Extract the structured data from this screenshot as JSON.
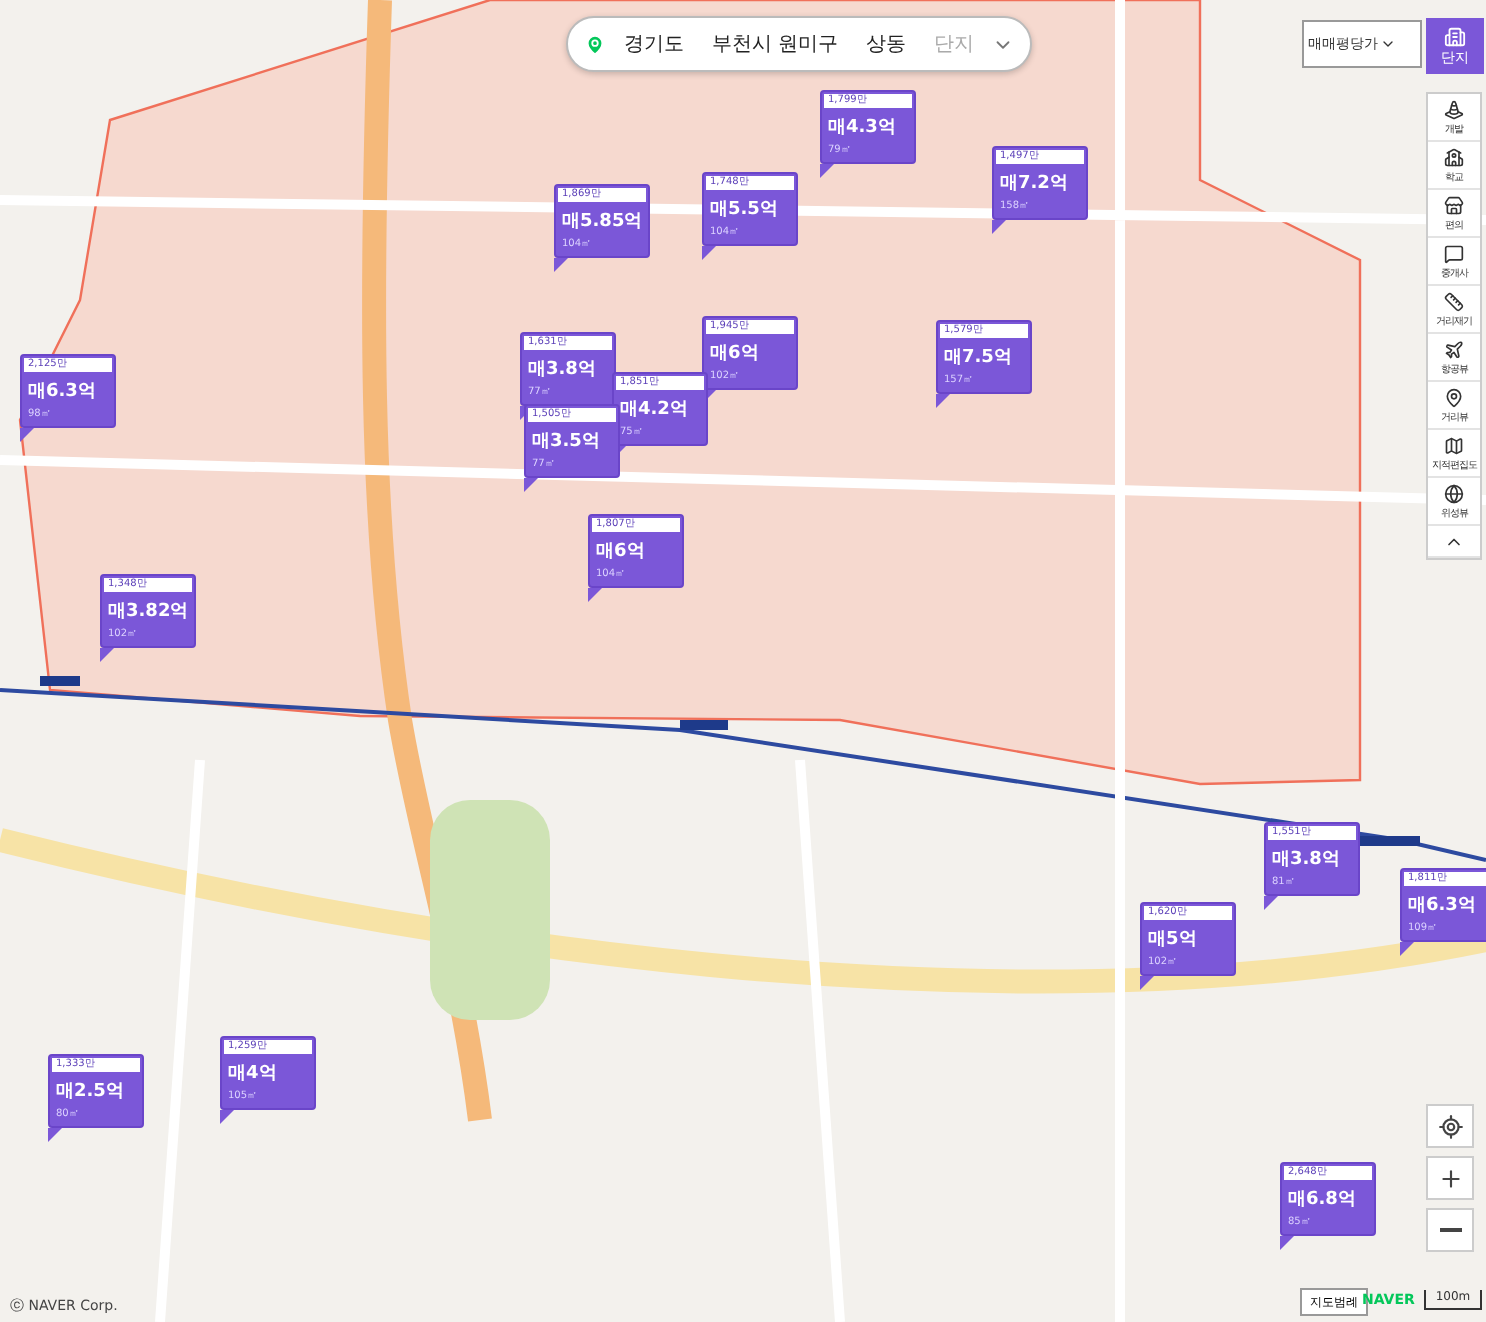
{
  "search_bar": {
    "crumbs": [
      {
        "label": "경기도",
        "muted": false
      },
      {
        "label": "부천시 원미구",
        "muted": false
      },
      {
        "label": "상동",
        "muted": false
      },
      {
        "label": "단지",
        "muted": true
      }
    ]
  },
  "price_type_select": {
    "value": "매매평당가"
  },
  "complex_button": {
    "label": "단지",
    "selected": true
  },
  "toolbar": [
    {
      "kind": "cone",
      "label": "개발"
    },
    {
      "kind": "school",
      "label": "학교"
    },
    {
      "kind": "store",
      "label": "편의"
    },
    {
      "kind": "agent",
      "label": "중개사"
    },
    {
      "kind": "ruler",
      "label": "거리재기"
    },
    {
      "kind": "plane",
      "label": "항공뷰"
    },
    {
      "kind": "pin",
      "label": "거리뷰"
    },
    {
      "kind": "map",
      "label": "지적편집도"
    },
    {
      "kind": "globe",
      "label": "위성뷰"
    },
    {
      "kind": "collapse"
    }
  ],
  "markers": [
    {
      "unit_price": "1,799만",
      "price": "매4.3억",
      "area": "79㎡"
    },
    {
      "unit_price": "1,869만",
      "price": "매5.85억",
      "area": "104㎡"
    },
    {
      "unit_price": "1,748만",
      "price": "매5.5억",
      "area": "104㎡"
    },
    {
      "unit_price": "1,497만",
      "price": "매7.2억",
      "area": "158㎡"
    },
    {
      "unit_price": "2,125만",
      "price": "매6.3억",
      "area": "98㎡"
    },
    {
      "unit_price": "1,945만",
      "price": "매6억",
      "area": "102㎡"
    },
    {
      "unit_price": "1,579만",
      "price": "매7.5억",
      "area": "157㎡"
    },
    {
      "unit_price": "1,631만",
      "price": "매3.8억",
      "area": "77㎡"
    },
    {
      "unit_price": "1,851만",
      "price": "매4.2억",
      "area": "75㎡"
    },
    {
      "unit_price": "1,505만",
      "price": "매3.5억",
      "area": "77㎡"
    },
    {
      "unit_price": "1,807만",
      "price": "매6억",
      "area": "104㎡"
    },
    {
      "unit_price": "1,348만",
      "price": "매3.82억",
      "area": "102㎡"
    },
    {
      "unit_price": "1,551만",
      "price": "매3.8억",
      "area": "81㎡"
    },
    {
      "unit_price": "1,811만",
      "price": "매6.3억",
      "area": "109㎡"
    },
    {
      "unit_price": "1,620만",
      "price": "매5억",
      "area": "102㎡"
    },
    {
      "unit_price": "1,259만",
      "price": "매4억",
      "area": "105㎡"
    },
    {
      "unit_price": "1,333만",
      "price": "매2.5억",
      "area": "80㎡"
    },
    {
      "unit_price": "2,648만",
      "price": "매6.8억",
      "area": "85㎡"
    }
  ],
  "copyright": "ⓒ NAVER Corp.",
  "legend_button": "지도범례",
  "logo": "NAVER",
  "scale": "100m"
}
